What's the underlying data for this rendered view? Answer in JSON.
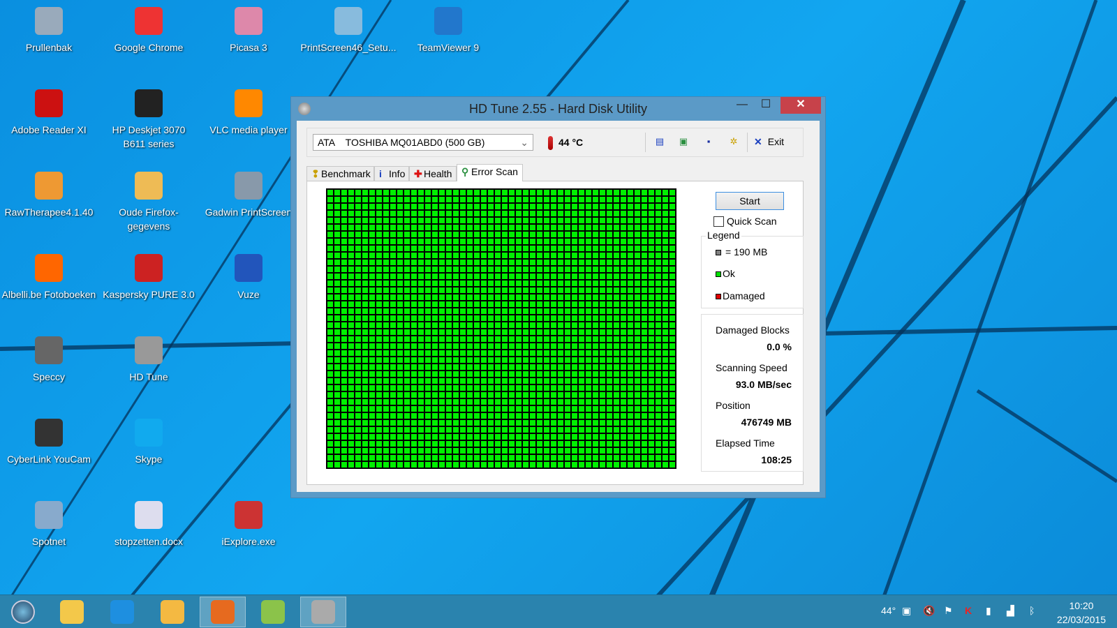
{
  "desktop": {
    "icons": [
      {
        "label": "Prullenbak",
        "color": "#9ab"
      },
      {
        "label": "Google Chrome",
        "color": "#e33"
      },
      {
        "label": "Picasa 3",
        "color": "#d8a"
      },
      {
        "label": "PrintScreen46_Setu...",
        "color": "#8bd"
      },
      {
        "label": "TeamViewer 9",
        "color": "#27c"
      },
      {
        "label": "Adobe Reader XI",
        "color": "#c11"
      },
      {
        "label": "HP Deskjet 3070 B611 series",
        "color": "#222"
      },
      {
        "label": "VLC media player",
        "color": "#f80"
      },
      {
        "label": "RawTherapee4.1.40",
        "color": "#e93"
      },
      {
        "label": "Oude Firefox-gegevens",
        "color": "#eb5"
      },
      {
        "label": "Gadwin PrintScreen",
        "color": "#89a"
      },
      {
        "label": "Albelli.be Fotoboeken",
        "color": "#f60"
      },
      {
        "label": "Kaspersky PURE 3.0",
        "color": "#c22"
      },
      {
        "label": "Vuze",
        "color": "#25b"
      },
      {
        "label": "Speccy",
        "color": "#666"
      },
      {
        "label": "HD Tune",
        "color": "#999"
      },
      {
        "label": "CyberLink YouCam",
        "color": "#333"
      },
      {
        "label": "Skype",
        "color": "#1ae"
      },
      {
        "label": "Spotnet",
        "color": "#8ac"
      },
      {
        "label": "stopzetten.docx",
        "color": "#dde"
      },
      {
        "label": "iExplore.exe",
        "color": "#c33"
      }
    ]
  },
  "window": {
    "title": "HD Tune 2.55 - Hard Disk Utility",
    "minimize": "—",
    "maximize": "☐",
    "close": "✕",
    "drive": "ATA    TOSHIBA MQ01ABD0 (500 GB)",
    "temperature": "44 °C",
    "toolbar_icons": [
      "copy-text-icon",
      "copy-image-icon",
      "save-icon",
      "options-icon"
    ],
    "exit_label": "Exit",
    "tabs": [
      {
        "label": "Benchmark",
        "icon": "❢"
      },
      {
        "label": "Info",
        "icon": "i"
      },
      {
        "label": "Health",
        "icon": "✚"
      },
      {
        "label": "Error Scan",
        "icon": "⚲"
      }
    ],
    "active_tab": "Error Scan",
    "scan": {
      "start_label": "Start",
      "quick_scan_label": "Quick Scan",
      "quick_scan_checked": false,
      "legend_title": "Legend",
      "legend": [
        {
          "label": "= 190 MB",
          "color": "#808080"
        },
        {
          "label": "Ok",
          "color": "#00e000"
        },
        {
          "label": "Damaged",
          "color": "#e00000"
        }
      ],
      "damaged_blocks_label": "Damaged Blocks",
      "damaged_blocks": "0.0 %",
      "speed_label": "Scanning Speed",
      "speed": "93.0 MB/sec",
      "position_label": "Position",
      "position": "476749 MB",
      "elapsed_label": "Elapsed Time",
      "elapsed": "108:25",
      "block_status": "ok",
      "block_color": "#00f000"
    }
  },
  "taskbar": {
    "apps": [
      {
        "name": "file-explorer",
        "color": "#f3c84a"
      },
      {
        "name": "internet-explorer",
        "color": "#1e8fe0"
      },
      {
        "name": "outlook",
        "color": "#f4b942"
      },
      {
        "name": "firefox",
        "color": "#e66a1f"
      },
      {
        "name": "zoner",
        "color": "#8bc34a"
      },
      {
        "name": "hd-tune",
        "color": "#aaa"
      }
    ],
    "tray_temp": "44°",
    "time": "10:20",
    "date": "22/03/2015"
  }
}
